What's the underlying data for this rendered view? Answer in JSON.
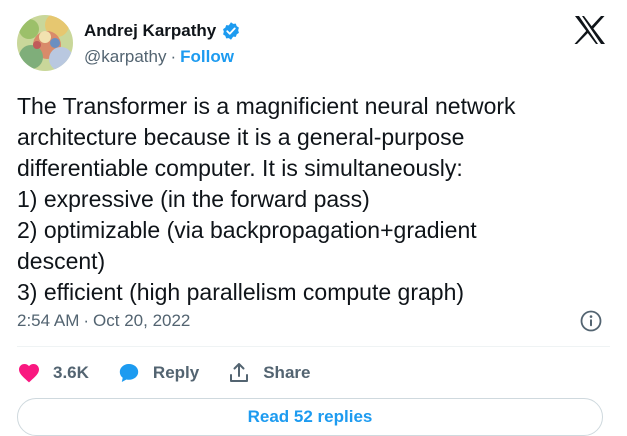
{
  "author": {
    "name": "Andrej Karpathy",
    "handle": "@karpathy",
    "separator": "·",
    "follow_label": "Follow",
    "verified_icon": "verified-badge-icon"
  },
  "tweet": {
    "lines": [
      "The Transformer is a magnificient neural network",
      "architecture because it is a general-purpose",
      "differentiable computer. It is simultaneously:",
      "1) expressive (in the forward pass)",
      "2) optimizable (via backpropagation+gradient",
      "descent)",
      "3) efficient (high parallelism compute graph)"
    ]
  },
  "meta": {
    "time": "2:54 AM",
    "separator": "·",
    "date": "Oct 20, 2022"
  },
  "actions": {
    "like_count": "3.6K",
    "reply_label": "Reply",
    "share_label": "Share"
  },
  "read_replies_label": "Read 52 replies",
  "colors": {
    "accent": "#1d9bf0",
    "like": "#f91880",
    "text": "#0f1419",
    "secondary": "#536471"
  }
}
